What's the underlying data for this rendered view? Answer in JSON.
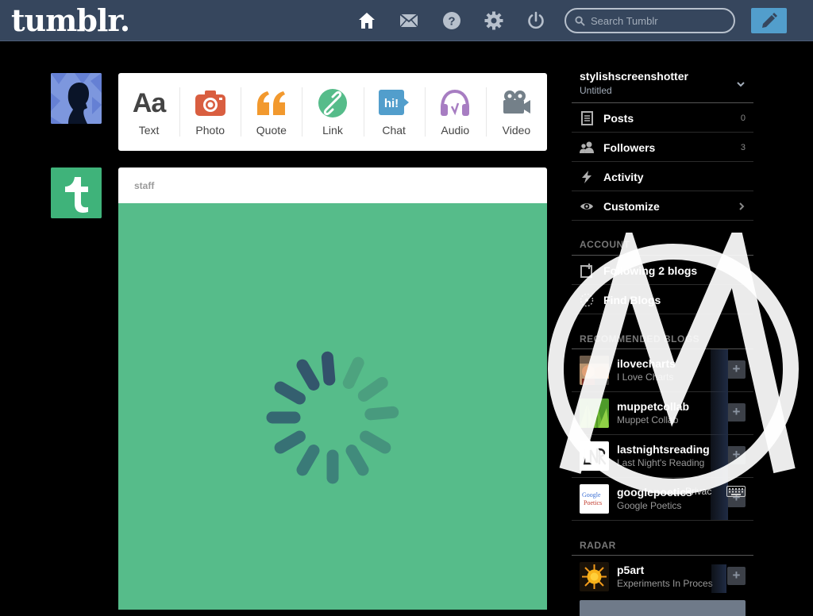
{
  "app": {
    "logo": "tumblr."
  },
  "header": {
    "nav": [
      {
        "name": "home-icon"
      },
      {
        "name": "mail-icon"
      },
      {
        "name": "help-icon"
      },
      {
        "name": "gear-icon"
      },
      {
        "name": "power-icon"
      }
    ],
    "search": {
      "placeholder": "Search Tumblr",
      "value": ""
    },
    "compose_icon": "pencil-icon"
  },
  "colors": {
    "header_bg": "#36465d",
    "accent_blue": "#529ecc",
    "post_media_bg": "#56bc8a",
    "text_icon": "#444444",
    "photo_icon": "#d95e40",
    "quote_icon": "#f2992e",
    "link_icon": "#56bc8a",
    "chat_icon": "#529ecc",
    "audio_icon": "#a77dc2",
    "video_icon": "#748089"
  },
  "post_types": [
    {
      "key": "text",
      "label": "Text",
      "icon": "text-icon"
    },
    {
      "key": "photo",
      "label": "Photo",
      "icon": "camera-icon"
    },
    {
      "key": "quote",
      "label": "Quote",
      "icon": "quote-icon"
    },
    {
      "key": "link",
      "label": "Link",
      "icon": "link-icon"
    },
    {
      "key": "chat",
      "label": "Chat",
      "icon": "chat-icon"
    },
    {
      "key": "audio",
      "label": "Audio",
      "icon": "headphones-icon"
    },
    {
      "key": "video",
      "label": "Video",
      "icon": "video-camera-icon"
    }
  ],
  "post": {
    "author": "staff",
    "loading": true
  },
  "sidebar": {
    "blog": {
      "name": "stylishscreenshotter",
      "title": "Untitled"
    },
    "items": [
      {
        "label": "Posts",
        "count": "0",
        "icon": "posts-icon"
      },
      {
        "label": "Followers",
        "count": "3",
        "icon": "followers-icon"
      },
      {
        "label": "Activity",
        "count": "",
        "icon": "lightning-icon"
      },
      {
        "label": "Customize",
        "count": "",
        "icon": "eye-icon"
      }
    ],
    "account": {
      "title": "ACCOUNT",
      "items": [
        {
          "label": "Following 2 blogs",
          "icon": "following-icon"
        },
        {
          "label": "Find Blogs",
          "icon": "compass-icon"
        }
      ]
    },
    "recommended": {
      "title": "RECOMMENDED BLOGS",
      "blogs": [
        {
          "name": "ilovecharts",
          "title": "I Love Charts"
        },
        {
          "name": "muppetcollab",
          "title": "Muppet Collab"
        },
        {
          "name": "lastnightsreading",
          "title": "Last Night's Reading"
        },
        {
          "name": "googlepoetics",
          "title": "Google Poetics"
        }
      ]
    },
    "radar": {
      "title": "RADAR",
      "blog": {
        "name": "p5art",
        "title": "Experiments In Proces"
      }
    }
  },
  "overlay": {
    "privacy_text": "Privac"
  }
}
